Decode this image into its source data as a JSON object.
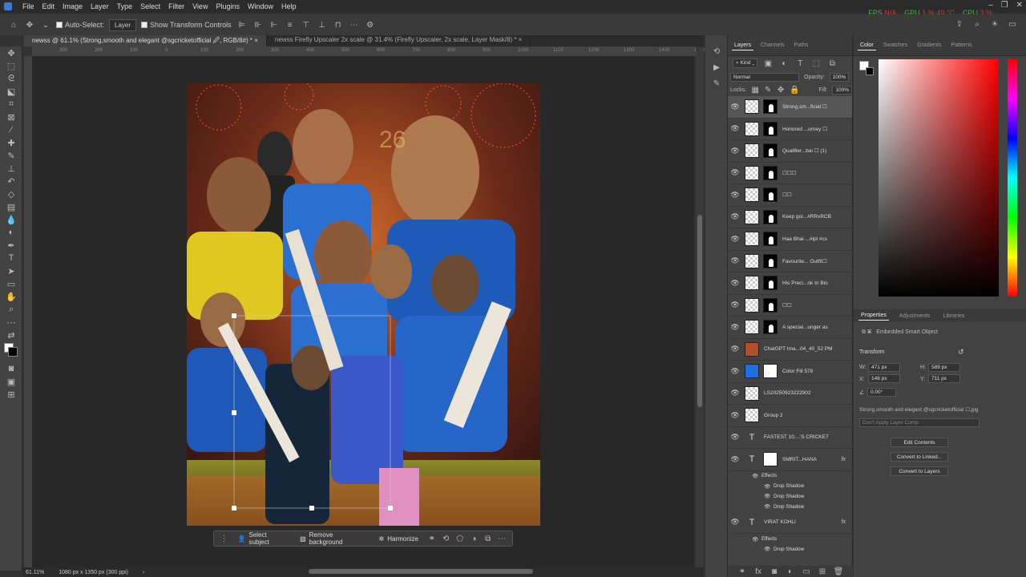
{
  "menu": [
    "File",
    "Edit",
    "Image",
    "Layer",
    "Type",
    "Select",
    "Filter",
    "View",
    "Plugins",
    "Window",
    "Help"
  ],
  "sys": {
    "fps_label": "FPS",
    "fps": "N/A",
    "gpu_label": "GPU",
    "gpu": "1 %",
    "gpu_temp": "49 °C",
    "cpu_label": "CPU",
    "cpu": "3 %"
  },
  "options": {
    "auto_select": "Auto-Select:",
    "layer_dd": "Layer",
    "show_transform": "Show Transform Controls"
  },
  "tabs": [
    "newss @ 61.1% (Strong,smooth and elegant @sgcricketofficial 🖉, RGB/8#) *",
    "newss Firefly Upscaler 2x scale @ 31.4% (Firefly Upscaler, 2x scale, Layer Mask/8) *"
  ],
  "ruler_ticks": [
    "400",
    "300",
    "200",
    "100",
    "0",
    "100",
    "200",
    "300",
    "400",
    "500",
    "600",
    "700",
    "800",
    "900",
    "1000",
    "1100",
    "1200",
    "1300",
    "1400",
    "1500"
  ],
  "context_bar": {
    "select_subject": "Select subject",
    "remove_bg": "Remove background",
    "harmonize": "Harmonize"
  },
  "status": {
    "zoom": "61.11%",
    "doc": "1080 px x 1350 px (300 ppi)"
  },
  "layers_panel": {
    "tabs": [
      "Layers",
      "Channels",
      "Paths"
    ],
    "kind": "Kind",
    "blend": "Normal",
    "opacity_label": "Opacity:",
    "opacity": "100%",
    "lock_label": "Locks:",
    "fill_label": "Fill:",
    "fill": "100%",
    "layers": [
      {
        "name": "Strong,sm...ficial ☐",
        "type": "smart-mask",
        "selected": true
      },
      {
        "name": "Honored ...urney ☐",
        "type": "smart-mask"
      },
      {
        "name": "Qualifier...bai ☐ (1)",
        "type": "smart-mask"
      },
      {
        "name": "☐☐☐",
        "type": "smart-mask"
      },
      {
        "name": "☐☐",
        "type": "smart-mask"
      },
      {
        "name": "Keep goi...#RRvRCB",
        "type": "smart-mask"
      },
      {
        "name": "Haa Bhai ...#ipl #cs",
        "type": "smart-mask"
      },
      {
        "name": "Favourite... Outfit☐",
        "type": "smart-mask"
      },
      {
        "name": "His Preci...nk In Bio",
        "type": "smart-mask"
      },
      {
        "name": "☐☐",
        "type": "smart-mask"
      },
      {
        "name": "A special...unger as",
        "type": "smart-mask"
      },
      {
        "name": "ChatGPT Ima...04_40_52 PM",
        "type": "image"
      },
      {
        "name": "Color Fill 578",
        "type": "fill"
      },
      {
        "name": "LS20250923222902",
        "type": "image"
      },
      {
        "name": "Group 2",
        "type": "image"
      },
      {
        "name": "FASTEST 10....'S CRICKET",
        "type": "text"
      },
      {
        "name": "SMRIT...HANA",
        "type": "text-mask",
        "fx": "fx"
      }
    ],
    "effects_label": "Effects",
    "drop_shadow": "Drop Shadow",
    "virat_layer": {
      "name": "VIRAT KOHLI",
      "fx": "fx"
    }
  },
  "color_panel": {
    "tabs": [
      "Color",
      "Swatches",
      "Gradients",
      "Patterns"
    ],
    "fg": "#ffffff",
    "bg": "#000000"
  },
  "properties": {
    "tabs": [
      "Properties",
      "Adjustments",
      "Libraries"
    ],
    "kind": "Embedded Smart Object",
    "transform_label": "Transform",
    "w_label": "W:",
    "w": "471 px",
    "h_label": "H:",
    "h": "589 px",
    "x_label": "X:",
    "x": "146 px",
    "y_label": "Y:",
    "y": "711 px",
    "angle": "0.00°",
    "filename": "Strong,smooth and elegant @sgcricketofficial ☐.jpg",
    "layer_comp": "Don't Apply Layer Comp",
    "edit_contents": "Edit Contents",
    "convert_linked": "Convert to Linked...",
    "convert_layers": "Convert to Layers"
  }
}
